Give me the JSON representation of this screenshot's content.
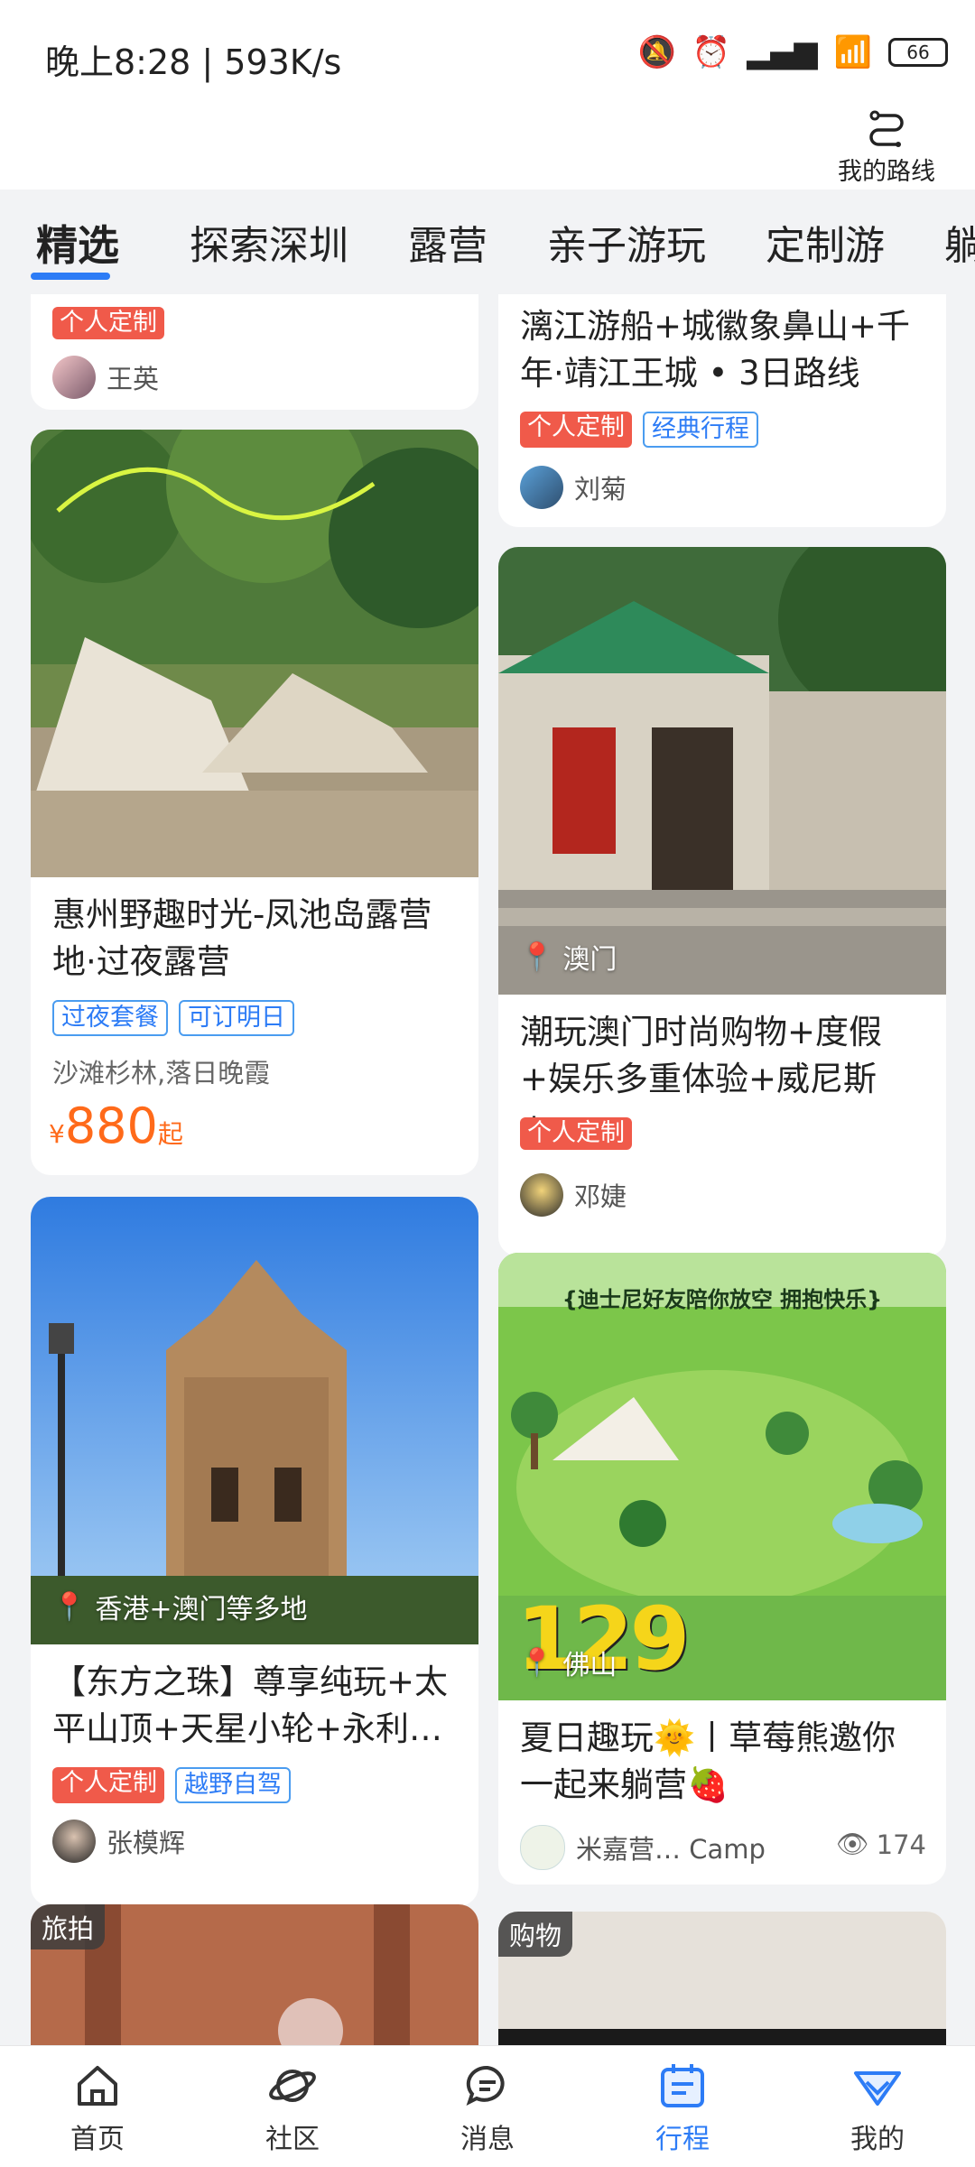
{
  "status": {
    "time": "晚上8:28 | 593K/s",
    "battery": "66"
  },
  "header": {
    "route_label": "我的路线"
  },
  "tabs": [
    "精选",
    "探索深圳",
    "露营",
    "亲子游玩",
    "定制游",
    "躺"
  ],
  "cards": {
    "c1": {
      "tag1": "个人定制",
      "author": "王英"
    },
    "c2": {
      "title": "漓江游船+城徽象鼻山+千年·靖江王城 • 3日路线",
      "tag1": "个人定制",
      "tag2": "经典行程",
      "author": "刘菊"
    },
    "c3": {
      "title": "惠州野趣时光-凤池岛露营地·过夜露营",
      "tag1": "过夜套餐",
      "tag2": "可订明日",
      "subtitle": "沙滩杉林,落日晚霞",
      "price_symbol": "¥",
      "price": "880",
      "price_suffix": "起"
    },
    "c4": {
      "location": "澳门",
      "title": "潮玩澳门时尚购物+度假+娱乐多重体验+威尼斯+…",
      "tag1": "个人定制",
      "author": "邓婕"
    },
    "c5": {
      "location": "香港+澳门等多地",
      "title": "【东方之珠】尊享纯玩+太平山顶+天星小轮+永利…",
      "tag1": "个人定制",
      "tag2": "越野自驾",
      "author": "张模辉"
    },
    "c6": {
      "location": "佛山",
      "poster_banner": "{迪士尼好友陪你放空 拥抱快乐}",
      "poster_price": "129",
      "title": "夏日趣玩🌞丨草莓熊邀你一起来躺营🍓",
      "author": "米嘉营… Camp",
      "views": "174"
    },
    "c7": {
      "badge": "旅拍"
    },
    "c8": {
      "badge": "购物"
    }
  },
  "nav": [
    {
      "label": "首页"
    },
    {
      "label": "社区"
    },
    {
      "label": "消息"
    },
    {
      "label": "行程"
    },
    {
      "label": "我的"
    }
  ],
  "colors": {
    "accent": "#2d7cf6",
    "tag_red": "#f05a4a",
    "price": "#ff6a1a"
  }
}
